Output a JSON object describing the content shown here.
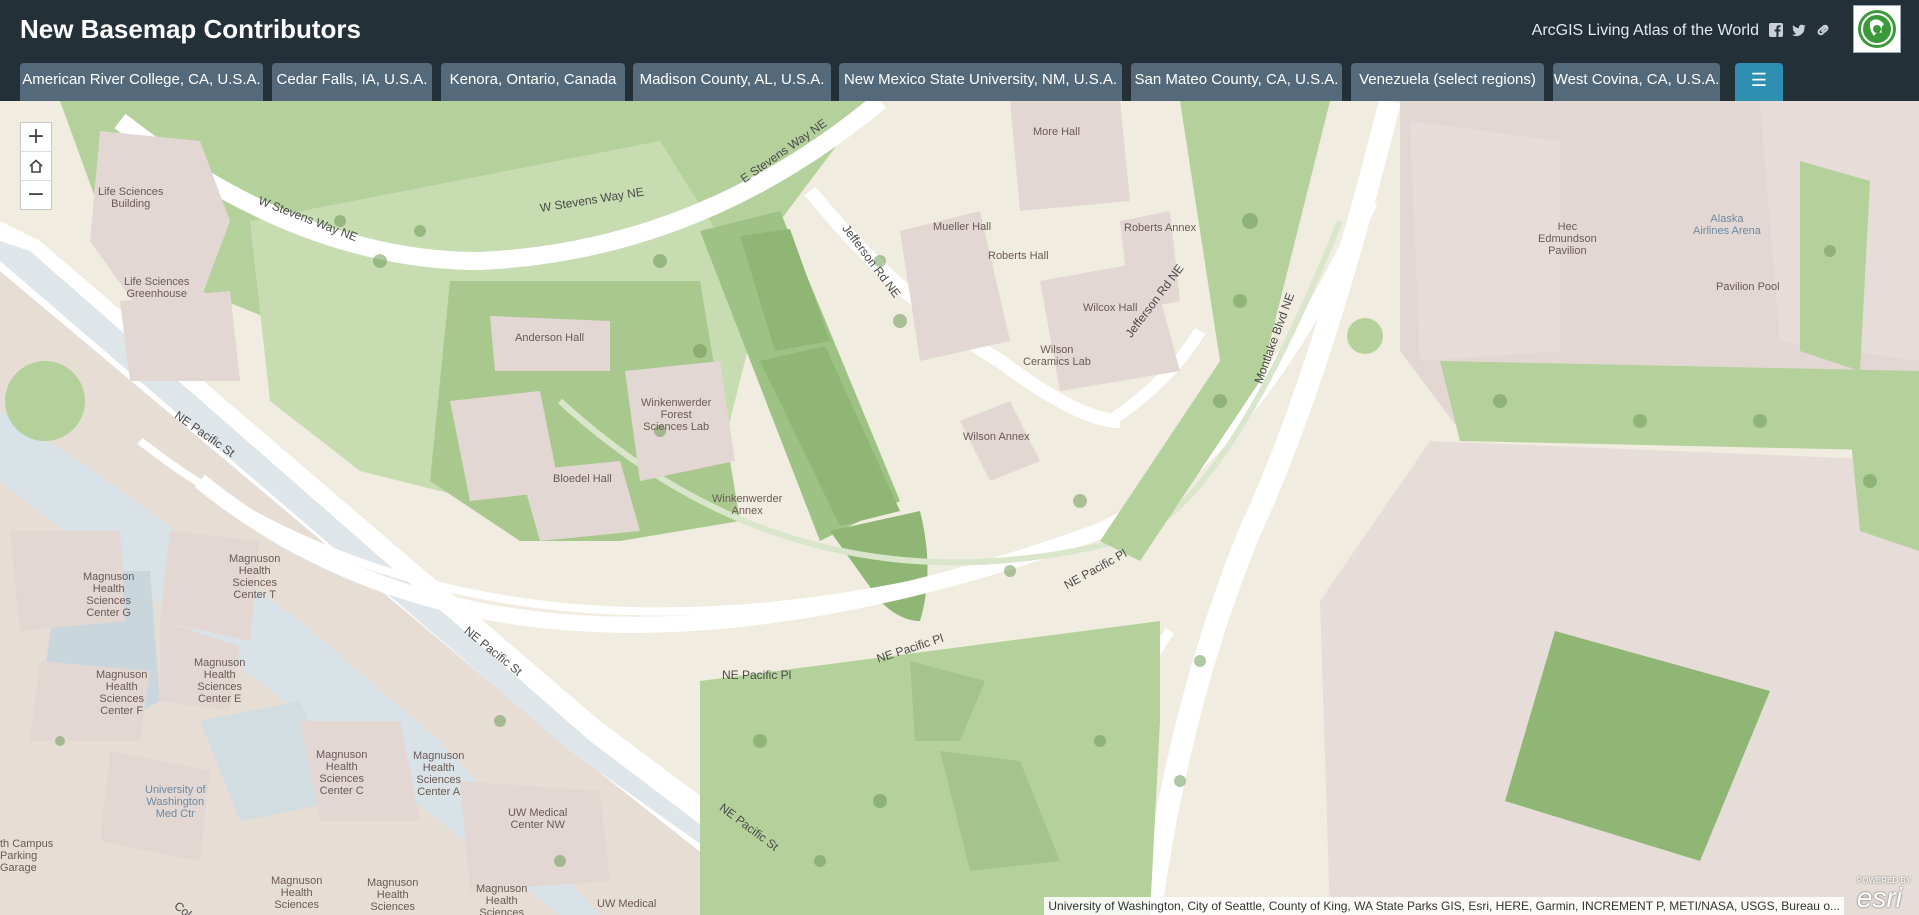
{
  "header": {
    "title": "New Basemap Contributors",
    "atlas_link": "ArcGIS Living Atlas of the World",
    "facebook_icon": "facebook-icon",
    "twitter_icon": "twitter-icon",
    "link_icon": "link-icon",
    "logo": "living-atlas-logo"
  },
  "tabs": [
    {
      "label": "American River College, CA, U.S.A."
    },
    {
      "label": "Cedar Falls, IA, U.S.A."
    },
    {
      "label": "Kenora, Ontario, Canada"
    },
    {
      "label": "Madison County, AL, U.S.A."
    },
    {
      "label": "New Mexico State University, NM, U.S.A."
    },
    {
      "label": "San Mateo County, CA, U.S.A."
    },
    {
      "label": "Venezuela (select regions)"
    },
    {
      "label": "West Covina, CA, U.S.A."
    }
  ],
  "menu_icon": "list-icon",
  "colors": {
    "header_bg": "#233038",
    "tab_bg": "#54697a",
    "menu_tab_bg": "#2e8fb0",
    "green": "#a9c88e",
    "building": "#e2dad6",
    "road": "#ffffff"
  },
  "zoom": {
    "in": "+",
    "home_icon": "home-icon",
    "out": "−"
  },
  "map": {
    "buildings": [
      {
        "label": "Life Sciences\nBuilding"
      },
      {
        "label": "Life Sciences\nGreenhouse"
      },
      {
        "label": "Anderson Hall"
      },
      {
        "label": "More Hall"
      },
      {
        "label": "Mueller Hall"
      },
      {
        "label": "Roberts Annex"
      },
      {
        "label": "Roberts Hall"
      },
      {
        "label": "Wilcox Hall"
      },
      {
        "label": "Wilson\nCeramics Lab"
      },
      {
        "label": "Winkenwerder\nForest\nSciences Lab"
      },
      {
        "label": "Bloedel Hall"
      },
      {
        "label": "Winkenwerder\nAnnex"
      },
      {
        "label": "Wilson Annex"
      },
      {
        "label": "Hec\nEdmundson\nPavilion"
      },
      {
        "label": "Alaska\nAirlines Arena"
      },
      {
        "label": "Pavilion Pool"
      },
      {
        "label": "Magnuson\nHealth\nSciences\nCenter T"
      },
      {
        "label": "Magnuson\nHealth\nSciences\nCenter G"
      },
      {
        "label": "Magnuson\nHealth\nSciences\nCenter E"
      },
      {
        "label": "Magnuson\nHealth\nSciences\nCenter F"
      },
      {
        "label": "University of\nWashington\nMed Ctr"
      },
      {
        "label": "Magnuson\nHealth\nSciences\nCenter C"
      },
      {
        "label": "Magnuson\nHealth\nSciences\nCenter A"
      },
      {
        "label": "UW Medical\nCenter NW"
      },
      {
        "label": "th Campus\nParking\nGarage"
      },
      {
        "label": "Magnuson\nHealth\nSciences"
      },
      {
        "label": "Magnuson\nHealth\nSciences"
      },
      {
        "label": "Magnuson\nHealth\nSciences"
      },
      {
        "label": "UW Medical"
      }
    ],
    "roads": [
      {
        "label": "W Stevens Way NE"
      },
      {
        "label": "W Stevens Way NE"
      },
      {
        "label": "E Stevens Way NE"
      },
      {
        "label": "Jefferson Rd NE"
      },
      {
        "label": "Jefferson Rd NE"
      },
      {
        "label": "Montlake Blvd NE"
      },
      {
        "label": "NE Pacific St"
      },
      {
        "label": "NE Pacific St"
      },
      {
        "label": "NE Pacific St"
      },
      {
        "label": "NE Pacific Pl"
      },
      {
        "label": "NE Pacific Pl"
      },
      {
        "label": "NE Pacific Pl"
      },
      {
        "label": "Col"
      }
    ]
  },
  "attribution": "University of Washington, City of Seattle, County of King, WA State Parks GIS, Esri, HERE, Garmin, INCREMENT P, METI/NASA, USGS, Bureau o...",
  "esri": {
    "powered": "POWERED BY",
    "brand": "esri"
  }
}
